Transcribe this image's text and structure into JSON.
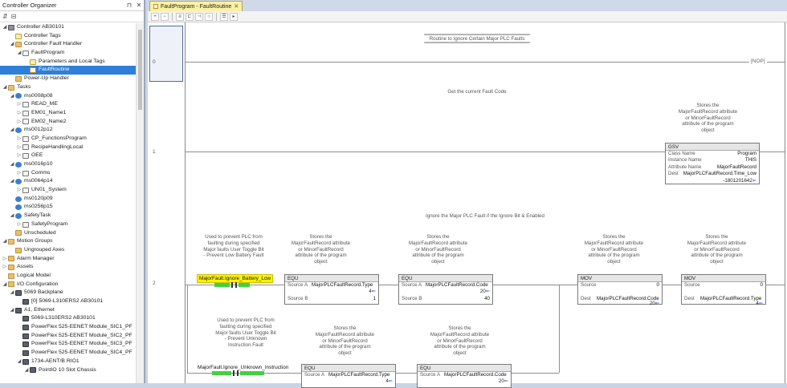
{
  "organizer": {
    "title": "Controller Organizer",
    "tree": [
      {
        "label": "Controller AB30101",
        "depth": 0,
        "toggle": "◢",
        "icon": "ctl"
      },
      {
        "label": "Controller Tags",
        "depth": 1,
        "toggle": "",
        "icon": "tag"
      },
      {
        "label": "Controller Fault Handler",
        "depth": 1,
        "toggle": "◢",
        "icon": "folder"
      },
      {
        "label": "FaultProgram",
        "depth": 2,
        "toggle": "◢",
        "icon": "prog"
      },
      {
        "label": "Parameters and Local Tags",
        "depth": 3,
        "toggle": "",
        "icon": "tag"
      },
      {
        "label": "FaultRoutine",
        "depth": 3,
        "toggle": "",
        "icon": "rout",
        "selected": true
      },
      {
        "label": "Power-Up Handler",
        "depth": 1,
        "toggle": "",
        "icon": "folder"
      },
      {
        "label": "Tasks",
        "depth": 0,
        "toggle": "◢",
        "icon": "folder"
      },
      {
        "label": "ms0008p08",
        "depth": 1,
        "toggle": "◢",
        "icon": "task"
      },
      {
        "label": "READ_ME",
        "depth": 2,
        "toggle": "▷",
        "icon": "prog"
      },
      {
        "label": "EM01_Name1",
        "depth": 2,
        "toggle": "▷",
        "icon": "prog"
      },
      {
        "label": "EM02_Name2",
        "depth": 2,
        "toggle": "▷",
        "icon": "prog"
      },
      {
        "label": "ms0012p12",
        "depth": 1,
        "toggle": "◢",
        "icon": "task"
      },
      {
        "label": "CP_FunctionsProgram",
        "depth": 2,
        "toggle": "▷",
        "icon": "prog"
      },
      {
        "label": "RecipeHandlingLocal",
        "depth": 2,
        "toggle": "▷",
        "icon": "prog"
      },
      {
        "label": "OEE",
        "depth": 2,
        "toggle": "▷",
        "icon": "prog"
      },
      {
        "label": "ms0016p10",
        "depth": 1,
        "toggle": "◢",
        "icon": "task"
      },
      {
        "label": "Comms",
        "depth": 2,
        "toggle": "▷",
        "icon": "prog"
      },
      {
        "label": "ms0064p14",
        "depth": 1,
        "toggle": "◢",
        "icon": "task"
      },
      {
        "label": "UN01_System",
        "depth": 2,
        "toggle": "▷",
        "icon": "prog"
      },
      {
        "label": "ms0120p09",
        "depth": 1,
        "toggle": "",
        "icon": "task"
      },
      {
        "label": "ms0256p15",
        "depth": 1,
        "toggle": "",
        "icon": "task"
      },
      {
        "label": "SafetyTask",
        "depth": 1,
        "toggle": "◢",
        "icon": "task"
      },
      {
        "label": "SafetyProgram",
        "depth": 2,
        "toggle": "▷",
        "icon": "prog"
      },
      {
        "label": "Unscheduled",
        "depth": 1,
        "toggle": "",
        "icon": "folder"
      },
      {
        "label": "Motion Groups",
        "depth": 0,
        "toggle": "◢",
        "icon": "folder"
      },
      {
        "label": "Ungrouped Axes",
        "depth": 1,
        "toggle": "",
        "icon": "folder"
      },
      {
        "label": "Alarm Manager",
        "depth": 0,
        "toggle": "▷",
        "icon": "folder"
      },
      {
        "label": "Assets",
        "depth": 0,
        "toggle": "▷",
        "icon": "folder"
      },
      {
        "label": "Logical Model",
        "depth": 0,
        "toggle": "",
        "icon": "folder"
      },
      {
        "label": "I/O Configuration",
        "depth": 0,
        "toggle": "◢",
        "icon": "folder"
      },
      {
        "label": "5069 Backplane",
        "depth": 1,
        "toggle": "◢",
        "icon": "dev"
      },
      {
        "label": "[0] 5069-L310ERS2 AB30101",
        "depth": 2,
        "toggle": "",
        "icon": "dev"
      },
      {
        "label": "A1, Ethernet",
        "depth": 1,
        "toggle": "◢",
        "icon": "dev"
      },
      {
        "label": "5069-L310ERS2 AB30101",
        "depth": 2,
        "toggle": "",
        "icon": "dev"
      },
      {
        "label": "PowerFlex 525-EENET Module_SIC1_PF",
        "depth": 2,
        "toggle": "",
        "icon": "dev"
      },
      {
        "label": "PowerFlex 525-EENET Module_SIC2_PF",
        "depth": 2,
        "toggle": "",
        "icon": "dev"
      },
      {
        "label": "PowerFlex 525-EENET Module_SIC3_PF",
        "depth": 2,
        "toggle": "",
        "icon": "dev"
      },
      {
        "label": "PowerFlex 525-EENET Module_SIC4_PF",
        "depth": 2,
        "toggle": "",
        "icon": "dev"
      },
      {
        "label": "1734-AENT/B RIO1",
        "depth": 2,
        "toggle": "◢",
        "icon": "dev"
      },
      {
        "label": "PointIO 10 Slot Chassis",
        "depth": 3,
        "toggle": "◢",
        "icon": "dev"
      }
    ]
  },
  "editor": {
    "tab_label": "FaultProgram - FaultRoutine",
    "rungs": {
      "r0": {
        "num": "0",
        "comment": "Routine to Ignore Certain Major PLC Faults",
        "nop": "[NOP]"
      },
      "r1": {
        "num": "1",
        "comment": "Get the current Fault Code",
        "desc": "Stores the MajorFaultRecord attribute or MinorFaultRecord attribute of the program object",
        "gsv": {
          "title": "GSV",
          "class_key": "Class Name",
          "class_val": "Program",
          "inst_key": "Instance Name",
          "inst_val": "THIS",
          "attr_key": "Attribute Name",
          "attr_val": "MajorFaultRecord",
          "dest_key": "Dest",
          "dest_val": "MajorPLCFaultRecord.Time_Low",
          "dest_num": "-1801201642"
        }
      },
      "r2": {
        "num": "2",
        "comment": "Ignore the Major PLC Fault if the Ignore Bit & Enabled",
        "xic1_desc": "Used to prevent PLC from faulting during specified Major faults User Toggle Bit - Prevent Low Battery Fault",
        "xic1_tag": "MajorFault.Ignore_Battery_Low",
        "desc": "Stores the MajorFaultRecord attribute or MinorFaultRecord attribute of the program object",
        "equ1": {
          "title": "EQU",
          "a_key": "Source A",
          "a_val": "MajorPLCFaultRecord.Type",
          "a_num": "4",
          "b_key": "Source B",
          "b_num": "1"
        },
        "equ2": {
          "title": "EQU",
          "a_key": "Source A",
          "a_val": "MajorPLCFaultRecord.Code",
          "a_num": "20",
          "b_key": "Source B",
          "b_num": "40"
        },
        "mov1": {
          "title": "MOV",
          "src_key": "Source",
          "src_num": "0",
          "dest_key": "Dest",
          "dest_val": "MajorPLCFaultRecord.Code",
          "dest_num": "20"
        },
        "mov2": {
          "title": "MOV",
          "src_key": "Source",
          "src_num": "0",
          "dest_key": "Dest",
          "dest_val": "MajorPLCFaultRecord.Type",
          "dest_num": "4"
        },
        "xic2_desc": "Used to prevent PLC from faulting during specified Major faults User Toggle Bit - Prevent Unknown Instruction Fault",
        "xic2_tag": "MajorFault.Ignore_Unknown_Instruction",
        "equ3": {
          "title": "EQU",
          "a_key": "Source A",
          "a_val": "MajorPLCFaultRecord.Type",
          "a_num": "4"
        },
        "equ4": {
          "title": "EQU",
          "a_key": "Source A",
          "a_val": "MajorPLCFaultRecord.Code",
          "a_num": "20"
        }
      }
    }
  },
  "colors": {
    "selection": "#2f7ed8",
    "tab": "#fbf0a3",
    "highlight": "#fff200",
    "energized": "#41d141",
    "arrow": "#1a4fe0"
  }
}
